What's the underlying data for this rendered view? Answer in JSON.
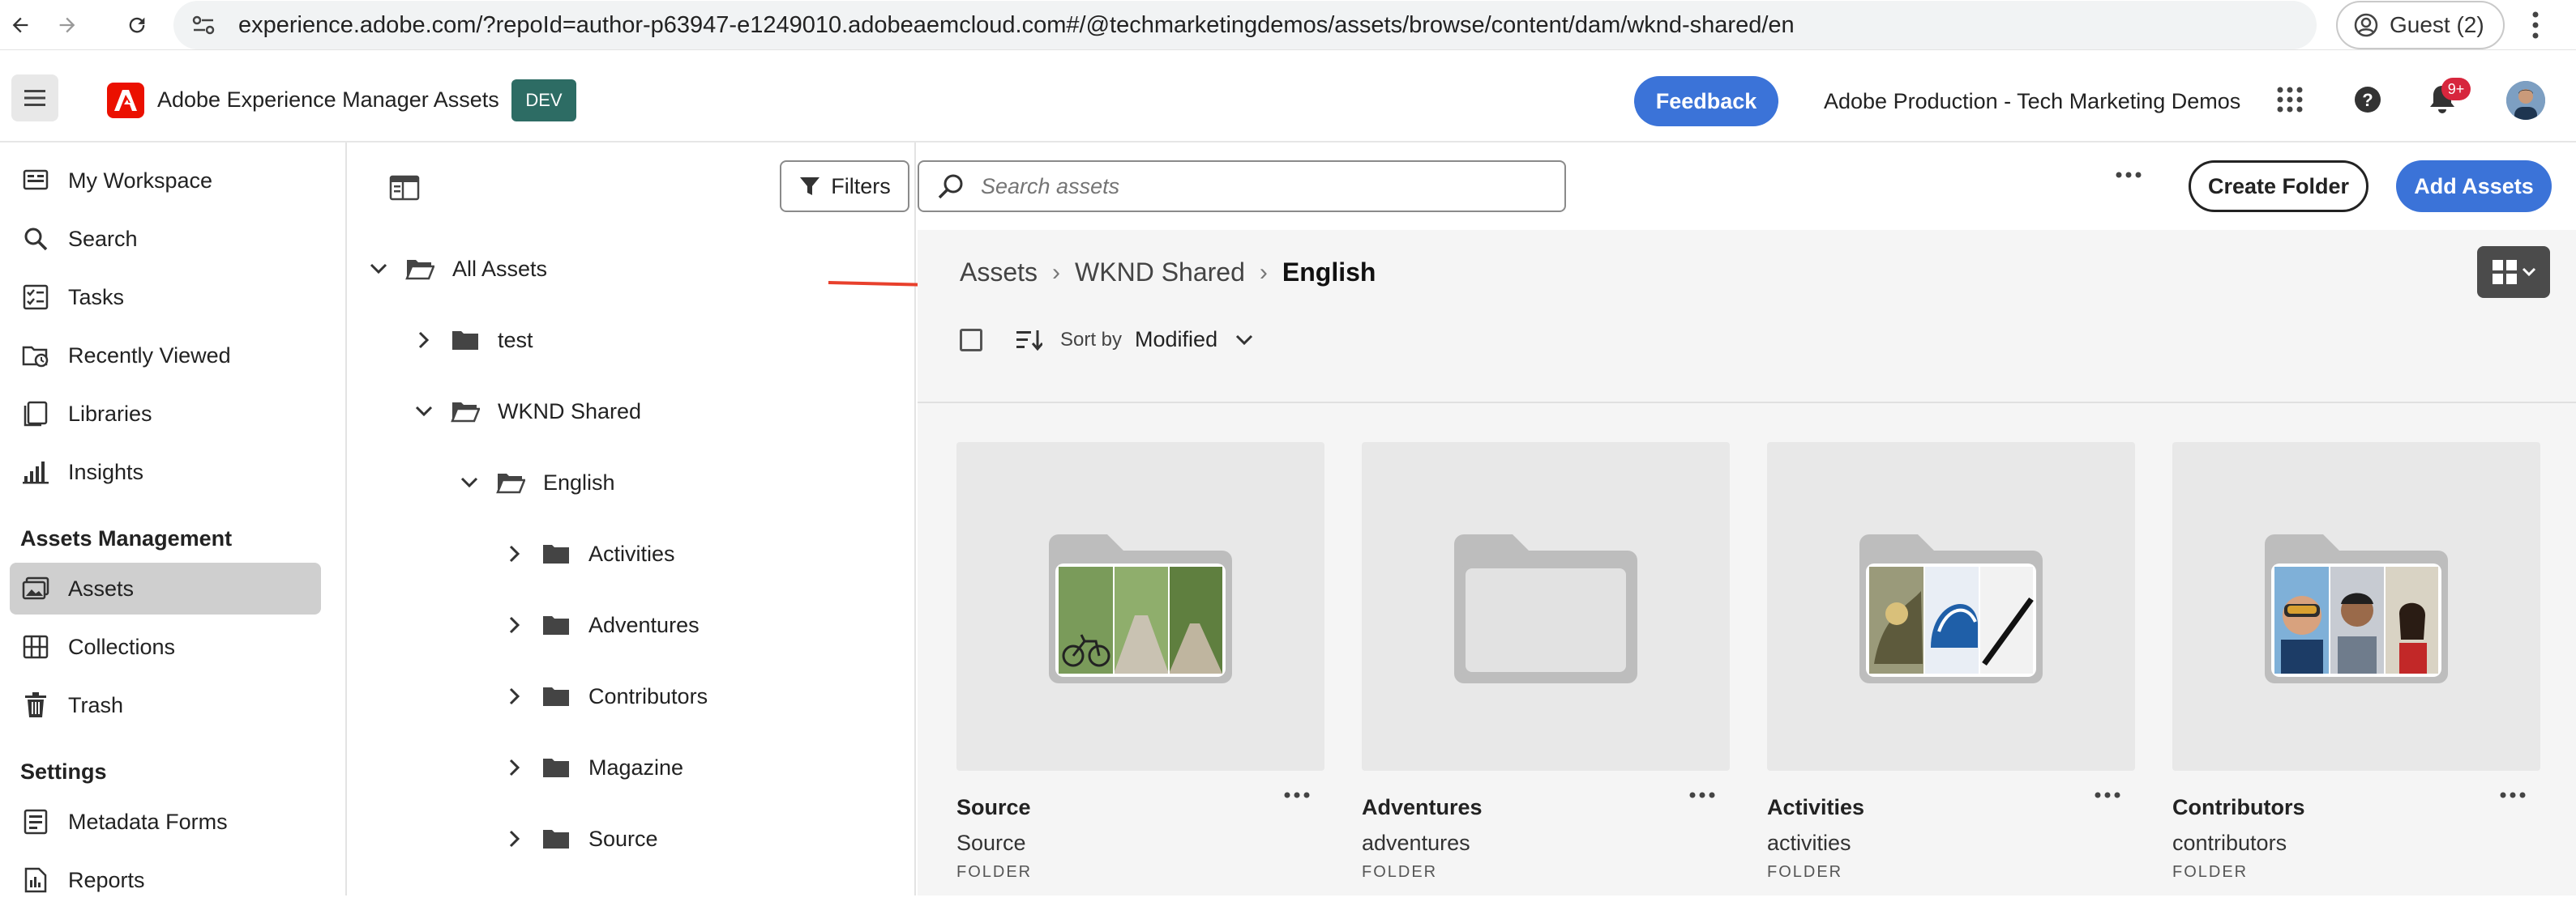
{
  "browser": {
    "url": "experience.adobe.com/?repoId=author-p63947-e1249010.adobeaemcloud.com#/@techmarketingdemos/assets/browse/content/dam/wknd-shared/en",
    "guest_label": "Guest (2)"
  },
  "header": {
    "app_title": "Adobe Experience Manager Assets",
    "env_badge": "DEV",
    "feedback_label": "Feedback",
    "org_name": "Adobe Production - Tech Marketing Demos",
    "notification_count": "9+"
  },
  "sidebar": {
    "items": [
      {
        "label": "My Workspace",
        "icon": "workspace-icon"
      },
      {
        "label": "Search",
        "icon": "search-icon"
      },
      {
        "label": "Tasks",
        "icon": "tasks-icon"
      },
      {
        "label": "Recently Viewed",
        "icon": "recent-icon"
      },
      {
        "label": "Libraries",
        "icon": "libraries-icon"
      },
      {
        "label": "Insights",
        "icon": "insights-icon"
      }
    ],
    "section_assets": "Assets Management",
    "assets_items": [
      {
        "label": "Assets",
        "icon": "assets-icon",
        "active": true
      },
      {
        "label": "Collections",
        "icon": "collections-icon"
      },
      {
        "label": "Trash",
        "icon": "trash-icon"
      }
    ],
    "section_settings": "Settings",
    "settings_items": [
      {
        "label": "Metadata Forms",
        "icon": "metadata-forms-icon"
      },
      {
        "label": "Reports",
        "icon": "reports-icon"
      }
    ]
  },
  "tree": {
    "root": "All Assets",
    "items": [
      "test",
      "WKND Shared",
      "English",
      "Activities",
      "Adventures",
      "Contributors",
      "Magazine",
      "Source"
    ]
  },
  "toolbar": {
    "filters_label": "Filters",
    "search_placeholder": "Search assets",
    "create_folder_label": "Create Folder",
    "add_assets_label": "Add Assets"
  },
  "breadcrumb": {
    "items": [
      "Assets",
      "WKND Shared",
      "English"
    ]
  },
  "sort": {
    "label": "Sort by",
    "value": "Modified"
  },
  "cards": [
    {
      "title": "Source",
      "subtitle": "Source",
      "type": "FOLDER",
      "thumb": "bike-trail"
    },
    {
      "title": "Adventures",
      "subtitle": "adventures",
      "type": "FOLDER",
      "thumb": "empty"
    },
    {
      "title": "Activities",
      "subtitle": "activities",
      "type": "FOLDER",
      "thumb": "helmet"
    },
    {
      "title": "Contributors",
      "subtitle": "contributors",
      "type": "FOLDER",
      "thumb": "people"
    }
  ],
  "colors": {
    "accent": "#3b73d8",
    "adobe_red": "#eb1000",
    "dev_badge": "#2d6c64",
    "annotation_arrow": "#e8402c"
  }
}
